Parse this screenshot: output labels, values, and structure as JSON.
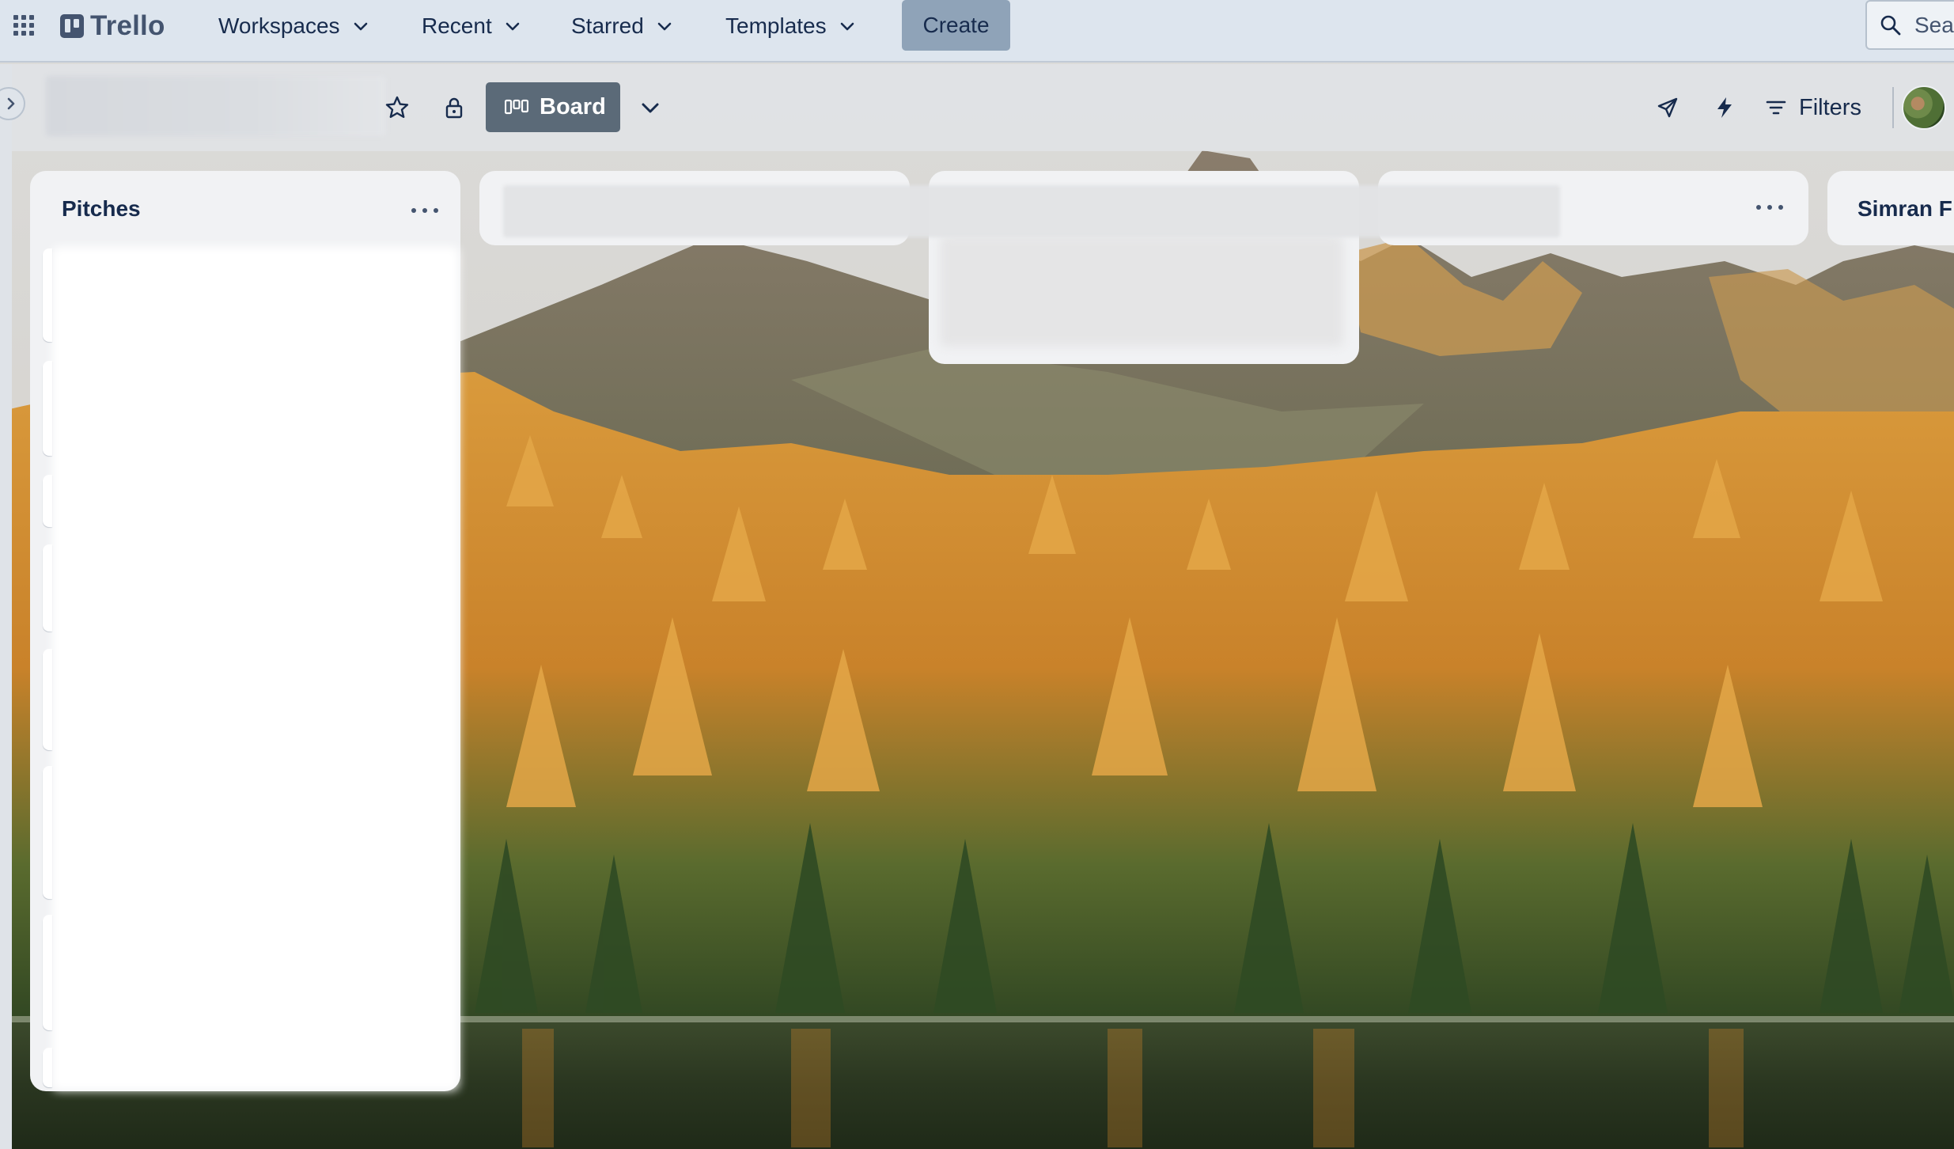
{
  "app": {
    "name": "Trello",
    "brand_color": "#44546f",
    "topbar_color": "#dde5ee"
  },
  "topbar": {
    "apps_icon": "grid-icon",
    "nav": [
      {
        "label": "Workspaces",
        "icon": "chevron-down-icon"
      },
      {
        "label": "Recent",
        "icon": "chevron-down-icon"
      },
      {
        "label": "Starred",
        "icon": "chevron-down-icon"
      },
      {
        "label": "Templates",
        "icon": "chevron-down-icon"
      }
    ],
    "create_label": "Create",
    "search_text": "Sea"
  },
  "board_header": {
    "title": "",
    "star_icon": "star-icon",
    "visibility_icon": "lock-icon",
    "view_label": "Board",
    "view_icon": "board-icon",
    "view_menu_icon": "chevron-down-icon",
    "power_ups_icon": "rocket-icon",
    "automation_icon": "lightning-icon",
    "filters_label": "Filters",
    "filters_icon": "filter-icon",
    "avatar": "member-avatar"
  },
  "lists": [
    {
      "title": "Pitches",
      "menu_icon": "more-icon"
    },
    {
      "title": ""
    },
    {
      "title": ""
    },
    {
      "title": "",
      "menu_icon": "more-icon"
    },
    {
      "title": "Simran F"
    }
  ],
  "colors": {
    "list_bg": "#f1f2f4",
    "board_button_bg": "#5b6a78",
    "create_button_bg": "#8fa3b8",
    "text": "#172b4d"
  }
}
